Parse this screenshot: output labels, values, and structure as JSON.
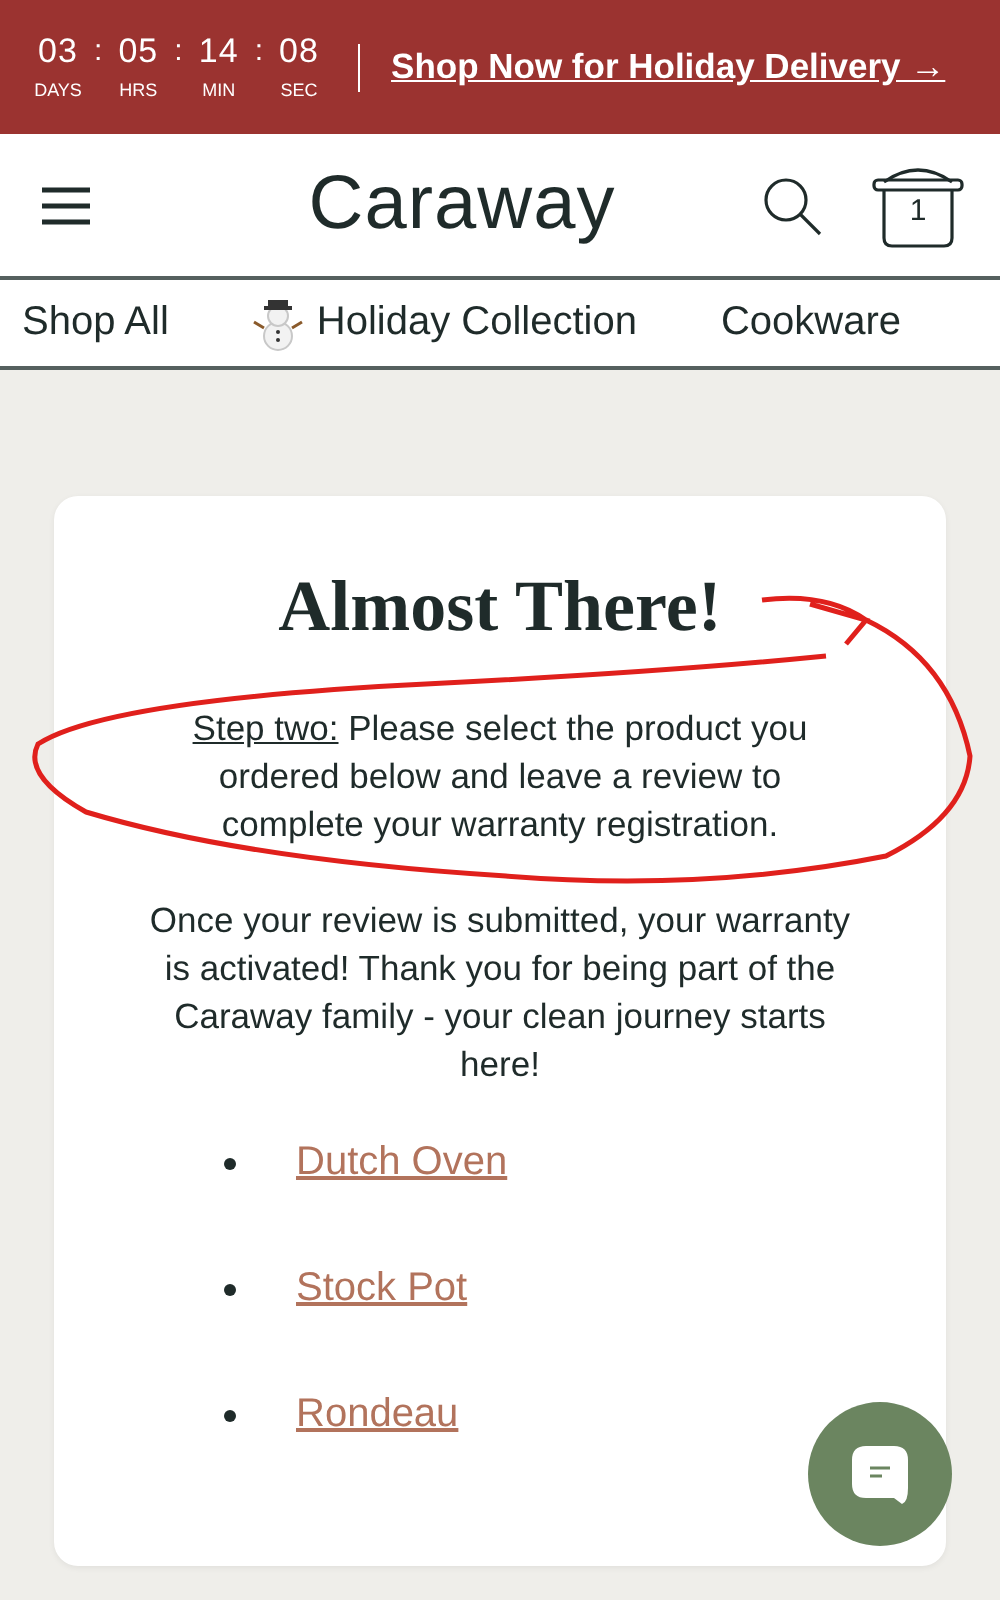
{
  "promo_bar": {
    "countdown": [
      {
        "value": "03",
        "label": "DAYS"
      },
      {
        "value": "05",
        "label": "HRS"
      },
      {
        "value": "14",
        "label": "MIN"
      },
      {
        "value": "08",
        "label": "SEC"
      }
    ],
    "separators": [
      ":",
      ":",
      ":"
    ],
    "link": "Shop Now for Holiday Delivery →"
  },
  "header": {
    "logo": "Caraway",
    "cart_count": "1"
  },
  "nav": [
    {
      "label": "Shop All",
      "kind": "text"
    },
    {
      "label": "Holiday Collection",
      "kind": "featured"
    },
    {
      "label": "Cookware",
      "kind": "text"
    }
  ],
  "card": {
    "title": "Almost There!",
    "step_label": "Step two:",
    "step_text": "Please select the product you ordered below and leave a review to complete your warranty registration.",
    "message": "Once your review is submitted, your warranty is activated! Thank you for being part of the Caraway family - your clean journey starts here!",
    "products": [
      "Dutch Oven",
      "Stock Pot",
      "Rondeau"
    ]
  }
}
